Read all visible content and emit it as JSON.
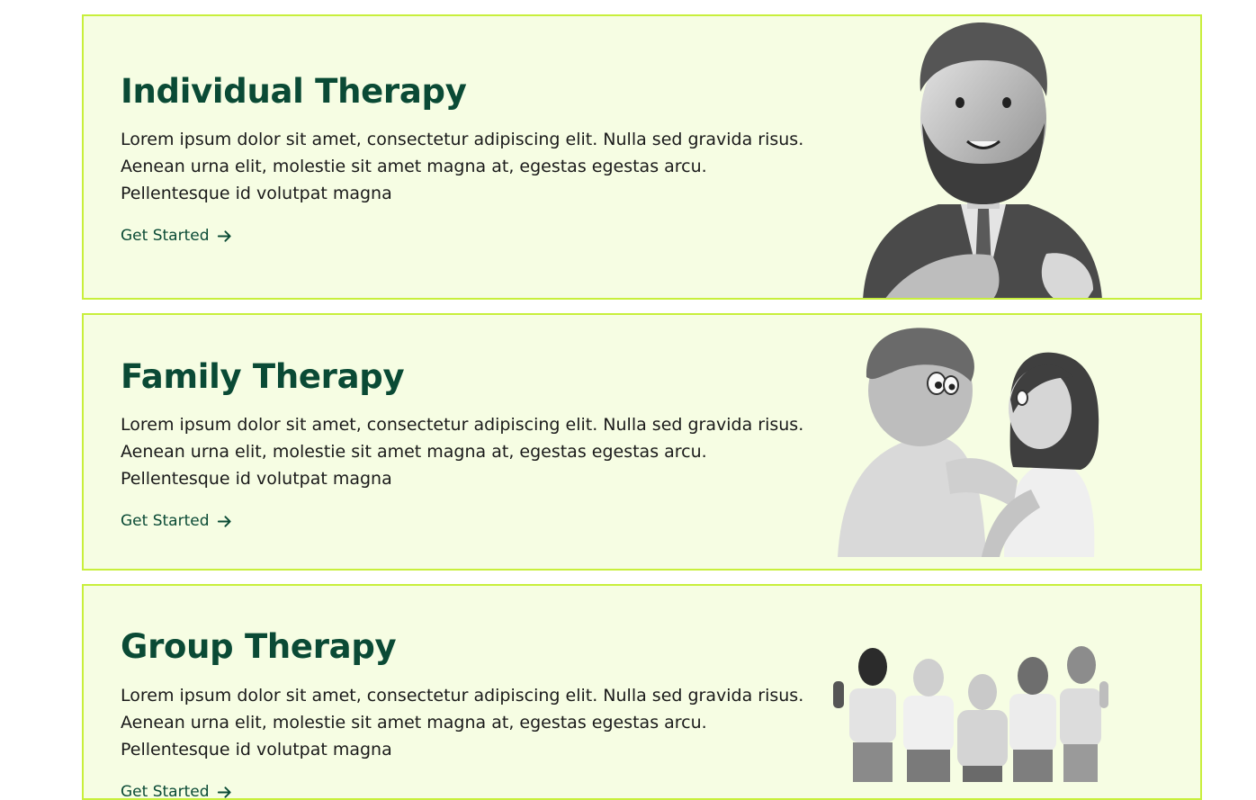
{
  "cards": [
    {
      "title": "Individual Therapy",
      "description": "Lorem ipsum dolor sit amet, consectetur adipiscing elit. Nulla sed gravida risus. Aenean urna elit, molestie sit amet magna at, egestas egestas arcu. Pellentesque id volutpat magna",
      "cta": "Get Started",
      "icon": "arrow-right-icon",
      "image": "bearded-man-in-suit-illustration"
    },
    {
      "title": "Family Therapy",
      "description": "Lorem ipsum dolor sit amet, consectetur adipiscing elit. Nulla sed gravida risus. Aenean urna elit, molestie sit amet magna at, egestas egestas arcu. Pellentesque id volutpat magna",
      "cta": "Get Started",
      "icon": "arrow-right-icon",
      "image": "couple-embracing-illustration"
    },
    {
      "title": "Group Therapy",
      "description": "Lorem ipsum dolor sit amet, consectetur adipiscing elit. Nulla sed gravida risus. Aenean urna elit, molestie sit amet magna at, egestas egestas arcu. Pellentesque id volutpat magna",
      "cta": "Get Started",
      "icon": "arrow-right-icon",
      "image": "group-thumbs-up-illustration"
    }
  ],
  "colors": {
    "card_background": "#f6fde3",
    "card_border": "#c8ef3c",
    "title": "#0a4a35",
    "body_text": "#1a1a1a"
  }
}
